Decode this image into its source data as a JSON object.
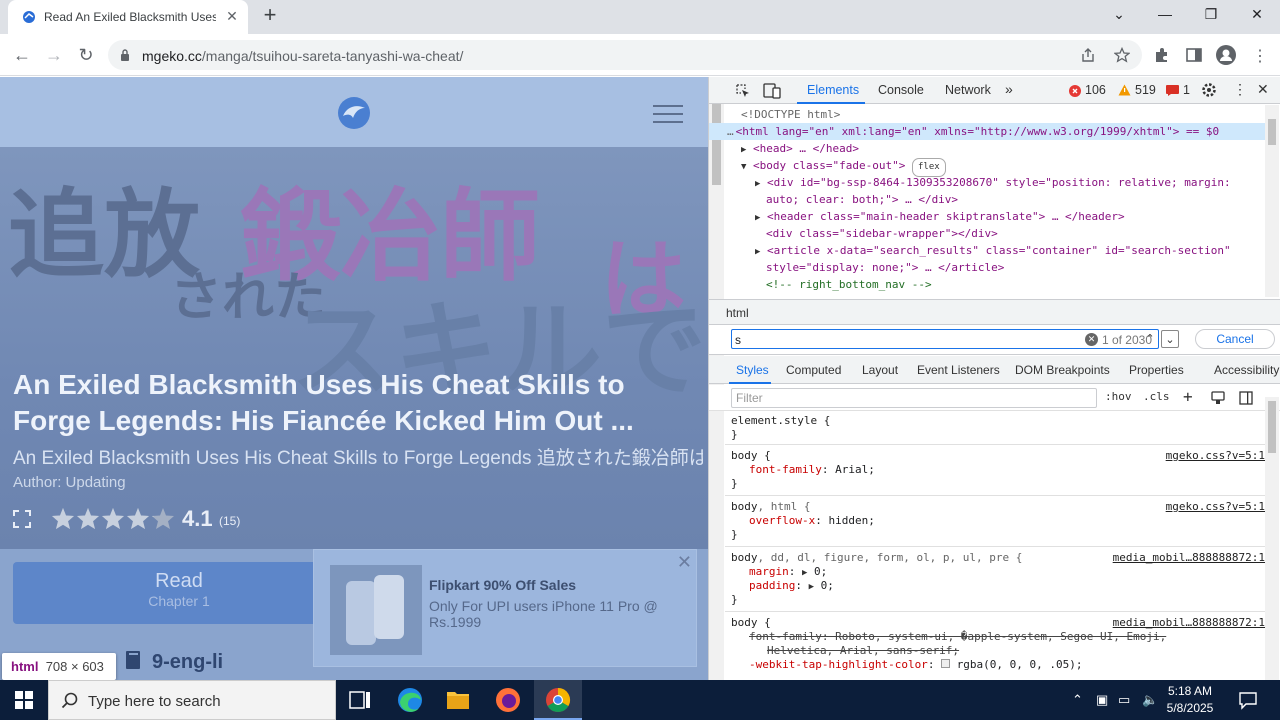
{
  "browser": {
    "tab_title": "Read An Exiled Blacksmith Uses His Cheat Skills to Forge Legends",
    "tab_close": "✕",
    "new_tab": "+",
    "url_domain": "mgeko.cc",
    "url_path": "/manga/tsuihou-sareta-tanyashi-wa-cheat/"
  },
  "page": {
    "title_line1": "An Exiled Blacksmith Uses His Cheat Skills to",
    "title_line2": "Forge Legends: His Fiancée Kicked Him Out ...",
    "alt_title": "An Exiled Blacksmith Uses His Cheat Skills to Forge Legends 追放された鍛冶師はチートスキルで伝説を造る",
    "author": "Author: Updating",
    "rating_value": "4.1",
    "rating_count": "(15)",
    "rating_stars": 4.1,
    "cover_kanji_top": "追放",
    "cover_kanji_main": "鍛冶師",
    "cover_kanji_ha": "は",
    "cover_sareta": "された",
    "cover_skill": "スキルで",
    "read_label": "Read",
    "read_sub": "Chapter 1",
    "chapter_label": "9-eng-li"
  },
  "ad": {
    "title": "Flipkart 90% Off Sales",
    "body": "Only For UPI users iPhone 11 Pro @ Rs.1999",
    "close": "✕"
  },
  "tooltip": {
    "tag": "html",
    "size": "708 × 603"
  },
  "devtools": {
    "tabs": [
      "Elements",
      "Console",
      "Network"
    ],
    "errors": "106",
    "warnings": "519",
    "issues": "1",
    "dom_lines": [
      "<!DOCTYPE html>",
      "<html lang=\"en\" xml:lang=\"en\" xmlns=\"http://www.w3.org/1999/xhtml\"> == $0",
      "<head> … </head>",
      "<body class=\"fade-out\">",
      "flex",
      "<div id=\"bg-ssp-8464-1309353208670\" style=\"position: relative; margin:",
      "auto; clear: both;\"> … </div>",
      "<header class=\"main-header skiptranslate\"> … </header>",
      "<div class=\"sidebar-wrapper\"></div>",
      "<article x-data=\"search_results\" class=\"container\" id=\"search-section\"",
      "style=\"display: none;\"> … </article>",
      "<!-- right_bottom_nav -->"
    ],
    "breadcrumb": "html",
    "search_value": "s",
    "search_count": "1 of 2030",
    "cancel": "Cancel",
    "style_tabs": [
      "Styles",
      "Computed",
      "Layout",
      "Event Listeners",
      "DOM Breakpoints",
      "Properties",
      "Accessibility"
    ],
    "filter_placeholder": "Filter",
    "hov": ":hov",
    "cls": ".cls",
    "rules": {
      "r0_sel": "element.style {",
      "r0_end": "}",
      "r1_sel": "body {",
      "r1_prop": "font-family",
      "r1_val": "Arial;",
      "r1_src": "mgeko.css?v=5:1",
      "r2_sel_a": "body",
      "r2_sel_b": ", html {",
      "r2_prop": "overflow-x",
      "r2_val": "hidden;",
      "r2_src": "mgeko.css?v=5:1",
      "r3_sel_a": "body",
      "r3_sel_b": ", dd, dl, figure, form, ol, p, ul, pre {",
      "r3_src": "media_mobil…888888872:1",
      "r3_prop1": "margin",
      "r3_val1": "0;",
      "r3_prop2": "padding",
      "r3_val2": "0;",
      "r4_sel": "body {",
      "r4_src": "media_mobil…888888872:1",
      "r4_line1": "font-family: Roboto, system-ui, �apple-system, Segoe UI, Emoji,",
      "r4_line2": "Helvetica, Arial, sans-serif;",
      "r4_prop3": "-webkit-tap-highlight-color",
      "r4_val3": "rgba(0, 0, 0, .05);"
    }
  },
  "taskbar": {
    "search_placeholder": "Type here to search",
    "time": "5:18 AM",
    "date": "5/8/2025"
  },
  "colors": {
    "accent": "#1a73e8",
    "tag": "#881280",
    "attr_name": "#994500",
    "attr_value": "#1a1aa6",
    "error": "#e53935",
    "warning": "#f29900"
  }
}
